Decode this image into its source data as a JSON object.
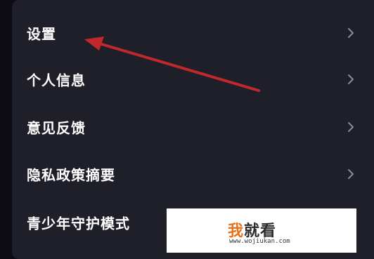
{
  "menu": {
    "items": [
      {
        "label": "设置"
      },
      {
        "label": "个人信息"
      },
      {
        "label": "意见反馈"
      },
      {
        "label": "隐私政策摘要"
      },
      {
        "label": "青少年守护模式"
      }
    ]
  },
  "annotation": {
    "arrow_color": "#c0282b"
  },
  "watermark": {
    "char1": "我",
    "rest": "就看",
    "url": "www.wojiukan.com",
    "accent_color": "#e8711a"
  },
  "colors": {
    "panel": "#1f1f2a",
    "text": "#ffffff",
    "chevron": "#8b8b96"
  }
}
